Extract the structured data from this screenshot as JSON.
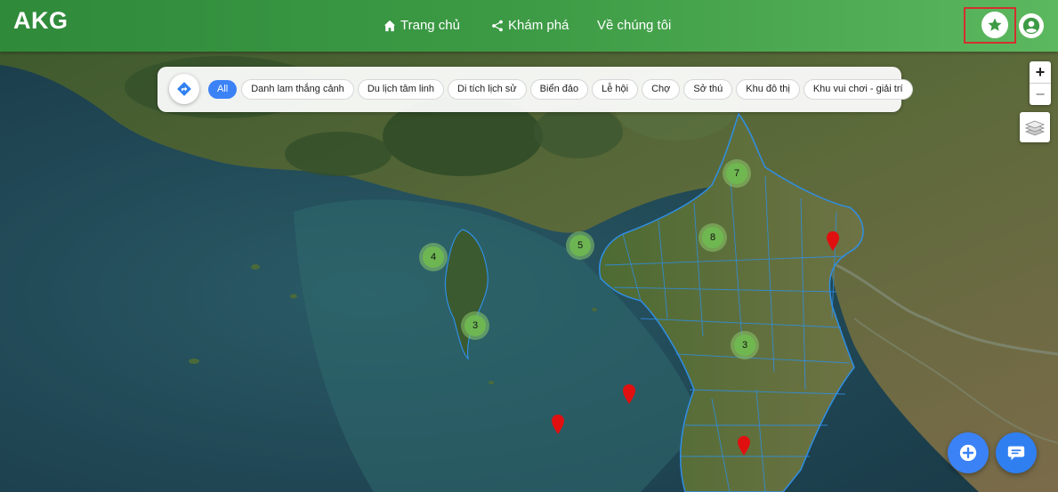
{
  "app": {
    "brand": "AKG"
  },
  "nav": {
    "home": {
      "label": "Trang chủ",
      "icon": "home-icon"
    },
    "explore": {
      "label": "Khám phá",
      "icon": "share-icon"
    },
    "about": {
      "label": "Về chúng tôi"
    }
  },
  "header_actions": {
    "favorites": {
      "icon": "star-icon",
      "highlighted": true
    },
    "account": {
      "icon": "user-circle-icon"
    }
  },
  "filters": {
    "route_icon": "directions-icon",
    "categories": [
      {
        "label": "All",
        "active": true
      },
      {
        "label": "Danh lam thắng cảnh",
        "active": false
      },
      {
        "label": "Du lịch tâm linh",
        "active": false
      },
      {
        "label": "Di tích lịch sử",
        "active": false
      },
      {
        "label": "Biển đảo",
        "active": false
      },
      {
        "label": "Lễ hội",
        "active": false
      },
      {
        "label": "Chợ",
        "active": false
      },
      {
        "label": "Sở thú",
        "active": false
      },
      {
        "label": "Khu đô thị",
        "active": false
      },
      {
        "label": "Khu vui chơi - giải trí",
        "active": false
      }
    ]
  },
  "map_controls": {
    "zoom_in": "+",
    "zoom_out": "−",
    "layers_icon": "layers-icon"
  },
  "clusters": [
    {
      "count": "7"
    },
    {
      "count": "8"
    },
    {
      "count": "5"
    },
    {
      "count": "4"
    },
    {
      "count": "3"
    },
    {
      "count": "3"
    }
  ],
  "markers_count": 4,
  "colors": {
    "brand_green": "#3d9b45",
    "accent_blue": "#3b82f6",
    "marker_red": "#e01010",
    "highlight_red": "#d32f2f",
    "cluster_green": "#6fb950",
    "boundary_blue": "#2f8fe6"
  },
  "fabs": {
    "add_icon": "plus-circle-icon",
    "chat_icon": "chat-icon"
  }
}
